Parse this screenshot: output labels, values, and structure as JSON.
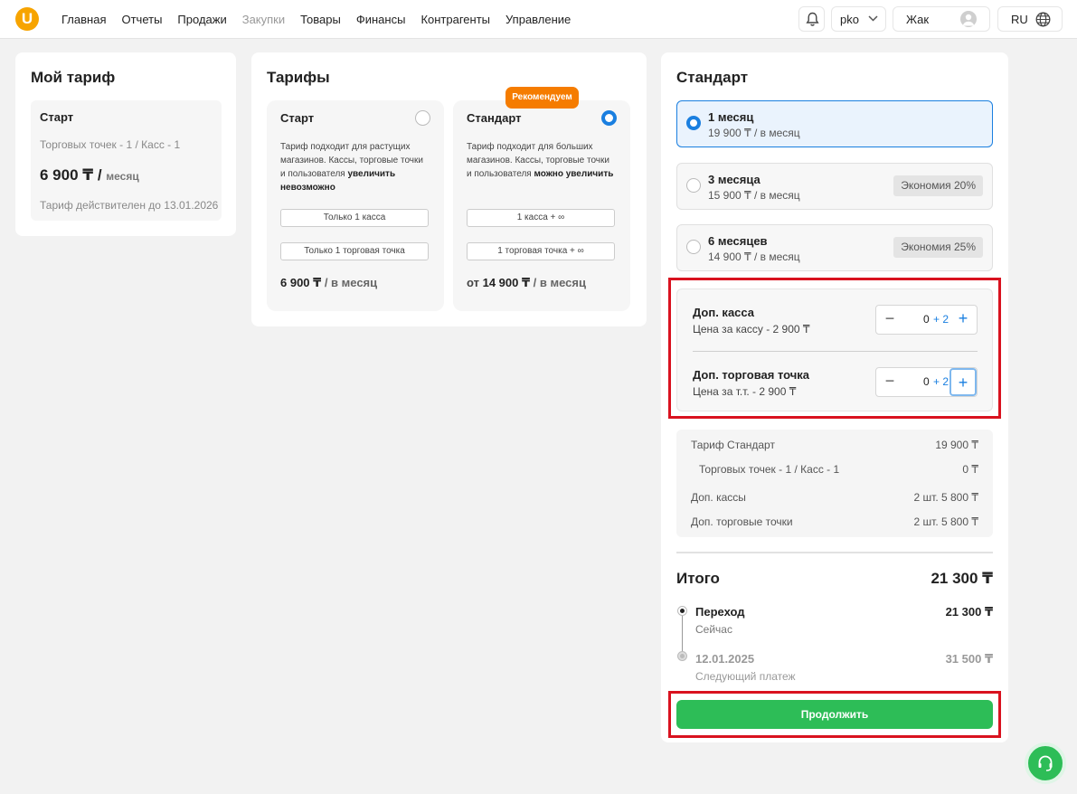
{
  "header": {
    "logo": "U",
    "nav": [
      {
        "label": "Главная",
        "disabled": false
      },
      {
        "label": "Отчеты",
        "disabled": false
      },
      {
        "label": "Продажи",
        "disabled": false
      },
      {
        "label": "Закупки",
        "disabled": true
      },
      {
        "label": "Товары",
        "disabled": false
      },
      {
        "label": "Финансы",
        "disabled": false
      },
      {
        "label": "Контрагенты",
        "disabled": false
      },
      {
        "label": "Управление",
        "disabled": false
      }
    ],
    "account": "pko",
    "user": "Жак",
    "language": "RU",
    "icons": [
      "bell-icon",
      "chevron-down-icon",
      "user-avatar-icon",
      "globe-icon"
    ]
  },
  "my_tariff": {
    "title": "Мой тариф",
    "name": "Старт",
    "points": "Торговых точек - 1 / Касс - 1",
    "price": "6 900 ₸ /",
    "per": "месяц",
    "valid": "Тариф действителен до 13.01.2026"
  },
  "tariffs": {
    "title": "Тарифы",
    "badge": "Рекомендуем",
    "items": [
      {
        "name": "Старт",
        "selected": false,
        "desc": "Тариф подходит для растущих магазинов. Кассы, торговые точки и пользователя ",
        "desc_bold": "увеличить невозможно",
        "chip1": "Только 1 касса",
        "chip2": "Только 1 торговая точка",
        "price": "6 900 ₸",
        "per": " / в месяц"
      },
      {
        "name": "Стандарт",
        "selected": true,
        "desc": "Тариф подходит для больших магазинов. Кассы, торговые точки и пользователя ",
        "desc_bold": "можно увеличить",
        "chip1": "1 касса + ∞",
        "chip2": "1 торговая точка + ∞",
        "price_prefix": "от ",
        "price": "14 900 ₸",
        "per": " / в месяц"
      }
    ]
  },
  "standard": {
    "title": "Стандарт",
    "periods": [
      {
        "title": "1 месяц",
        "price": "19 900 ₸ / в месяц",
        "save": "",
        "selected": true
      },
      {
        "title": "3 месяца",
        "price": "15 900 ₸ / в месяц",
        "save": "Экономия 20%",
        "selected": false
      },
      {
        "title": "6 месяцев",
        "price": "14 900 ₸ / в месяц",
        "save": "Экономия 25%",
        "selected": false
      }
    ],
    "addons": [
      {
        "title": "Доп. касса",
        "price": "Цена за кассу - 2 900 ₸",
        "value": "0",
        "delta": "+ 2"
      },
      {
        "title": "Доп. торговая точка",
        "price": "Цена за т.т. - 2 900 ₸",
        "value": "0",
        "delta": "+ 2"
      }
    ],
    "summary": [
      {
        "label": "Тариф Стандарт",
        "value": "19 900 ₸"
      },
      {
        "label": "Торговых точек - 1 / Касс - 1",
        "value": "0 ₸"
      },
      {
        "label": "Доп. кассы",
        "value": "2 шт. 5 800 ₸"
      },
      {
        "label": "Доп. торговые точки",
        "value": "2 шт. 5 800 ₸"
      }
    ],
    "total_label": "Итого",
    "total_value": "21 300 ₸",
    "timeline": [
      {
        "title": "Переход",
        "sub": "Сейчас",
        "value": "21 300 ₸"
      },
      {
        "title": "12.01.2025",
        "sub": "Следующий платеж",
        "value": "31 500 ₸"
      }
    ],
    "continue": "Продолжить"
  },
  "colors": {
    "accent": "#1a7fe0",
    "primary_button": "#2dbd57",
    "badge": "#f57c00",
    "highlight": "#d9121f",
    "logo": "#f7a400"
  }
}
